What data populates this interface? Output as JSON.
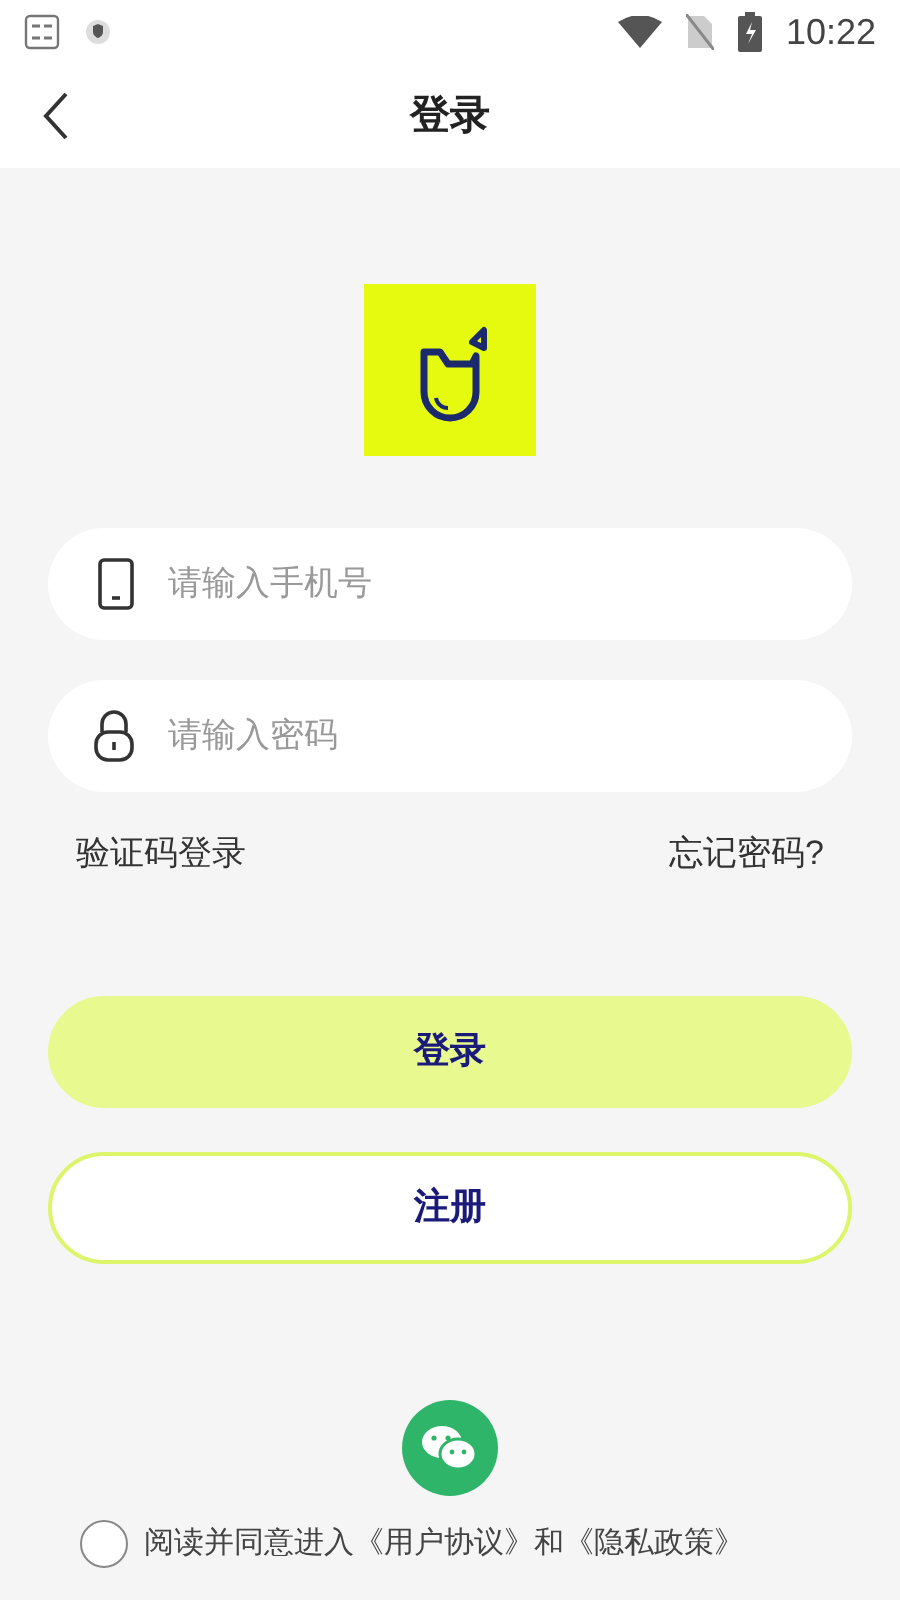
{
  "status_bar": {
    "time": "10:22"
  },
  "header": {
    "title": "登录"
  },
  "phone_field": {
    "placeholder": "请输入手机号"
  },
  "password_field": {
    "placeholder": "请输入密码"
  },
  "links": [
    {
      "label": "验证码登录"
    },
    {
      "label": "忘记密码?"
    }
  ],
  "buttons": [
    {
      "label": "登录",
      "kind": "filled"
    },
    {
      "label": "注册",
      "kind": "outline"
    }
  ],
  "agreement": {
    "checked": false,
    "text": "阅读并同意进入",
    "links": [
      "《用户协议》",
      "和",
      "《隐私政策》"
    ]
  }
}
